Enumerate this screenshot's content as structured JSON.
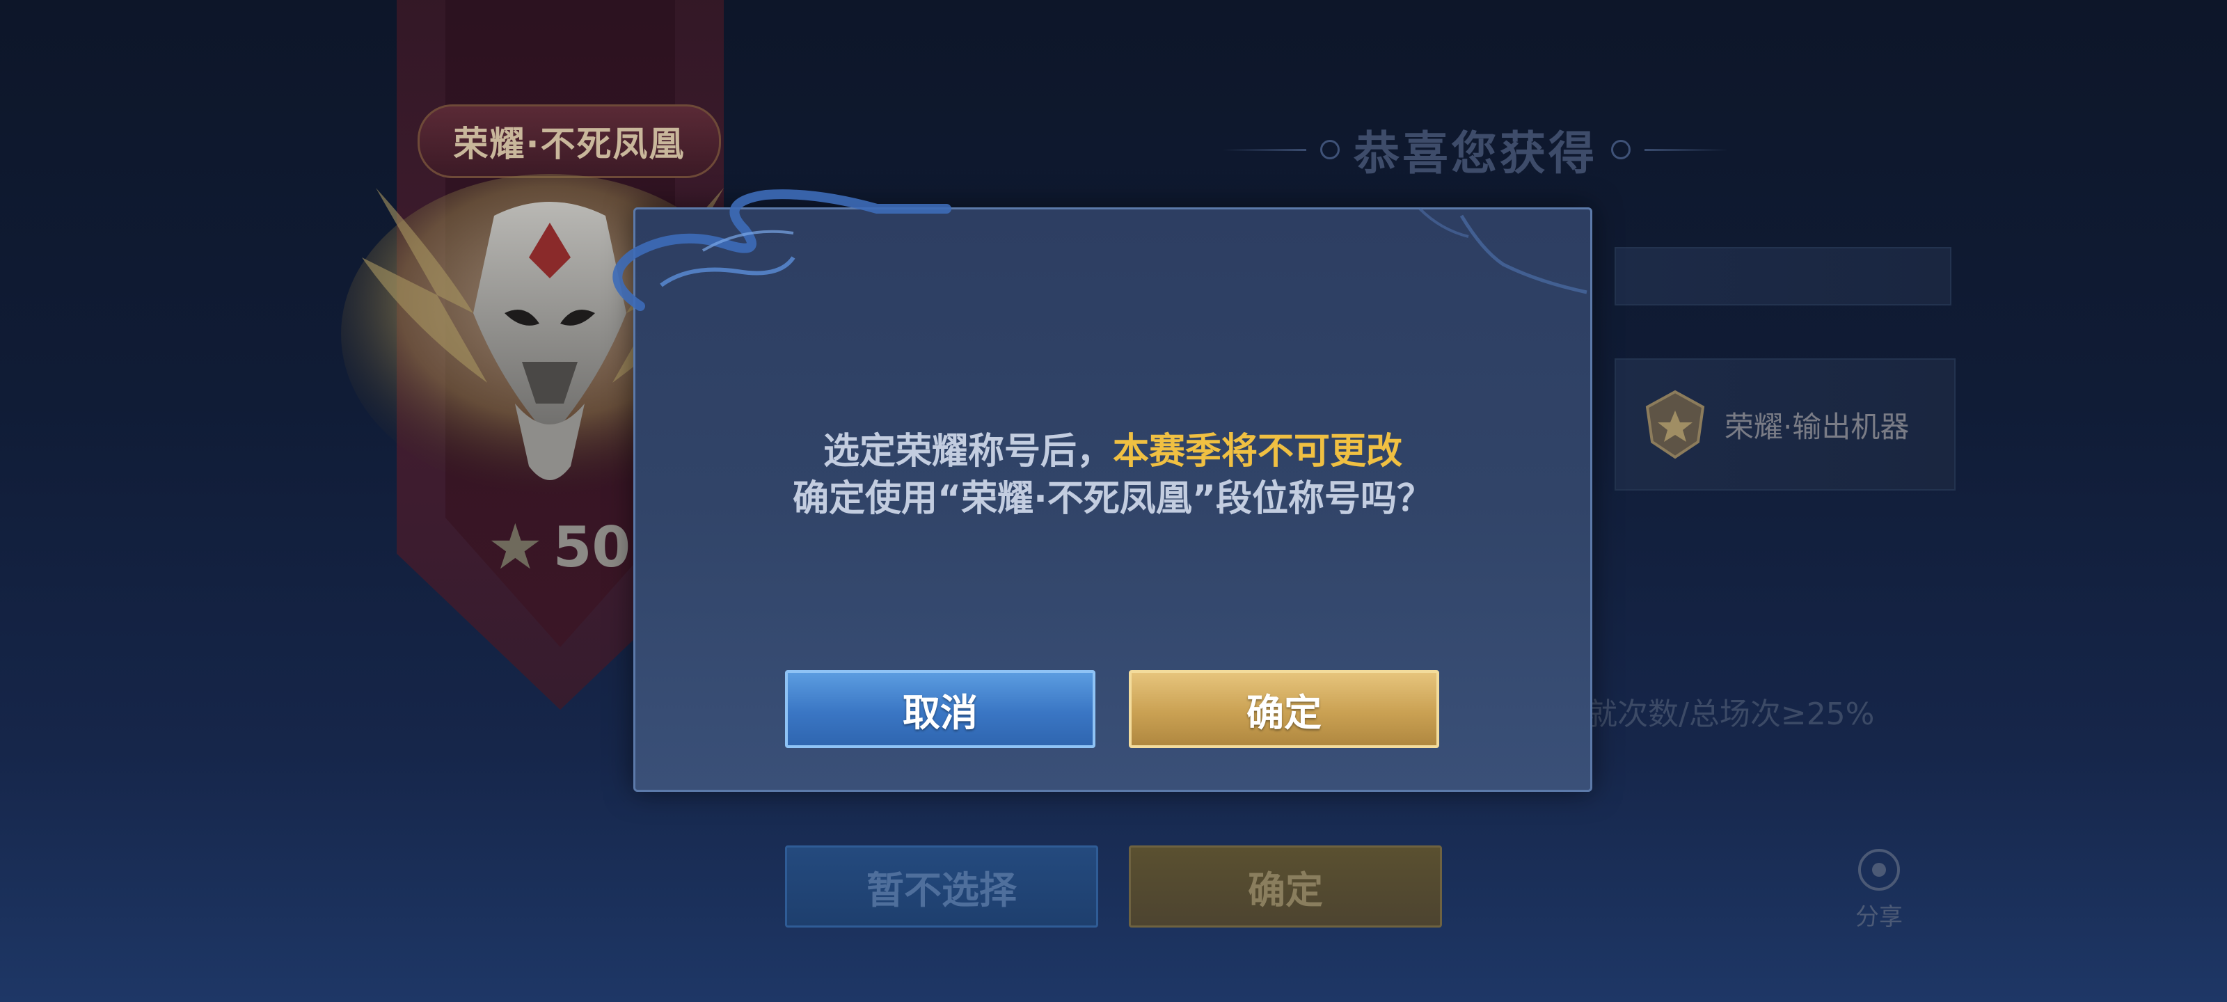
{
  "background": {
    "title_plaque": "荣耀·不死凤凰",
    "star_count": "50",
    "congrats_title": "恭喜您获得",
    "card_label": "荣耀·输出机器",
    "condition_text": "就次数/总场次≥25%",
    "ghost_cancel_label": "暂不选择",
    "ghost_ok_label": "确定",
    "share_label": "分享"
  },
  "modal": {
    "line1_prefix": "选定荣耀称号后，",
    "line1_highlight": "本赛季将不可更改",
    "line2": "确定使用“荣耀·不死凤凰”段位称号吗？",
    "cancel_label": "取消",
    "ok_label": "确定"
  },
  "colors": {
    "highlight": "#f0c042",
    "cancel_button": "#3a76c4",
    "ok_button": "#caa153"
  }
}
